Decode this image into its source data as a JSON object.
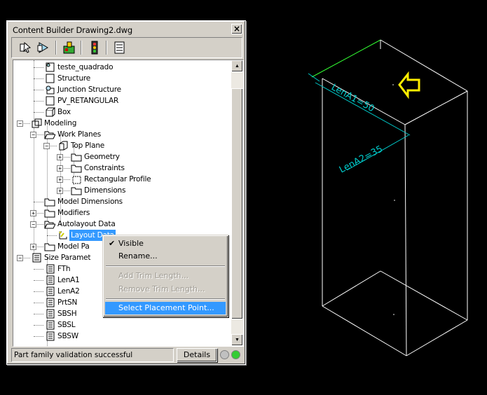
{
  "palette": {
    "title": "Content Builder Drawing2.dwg",
    "close_glyph": "×",
    "toolbar": [
      "model-icon",
      "browse-icon",
      "part-icon",
      "traffic-light-icon",
      "list-icon"
    ]
  },
  "tree": {
    "items": [
      {
        "label": "teste_quadrado",
        "icon": "part-doc-icon"
      },
      {
        "label": "Structure",
        "icon": "doc-icon"
      },
      {
        "label": "Junction Structure",
        "icon": "junction-icon"
      },
      {
        "label": "PV_RETANGULAR",
        "icon": "doc-icon"
      },
      {
        "label": "Box",
        "icon": "box-icon"
      },
      {
        "label": "Modeling",
        "icon": "modeling-icon",
        "expander": "−"
      },
      {
        "label": "Work Planes",
        "icon": "folder-open-icon",
        "expander": "−"
      },
      {
        "label": "Top Plane",
        "icon": "plane-icon",
        "expander": "−"
      },
      {
        "label": "Geometry",
        "icon": "folder-icon",
        "expander": "+"
      },
      {
        "label": "Constraints",
        "icon": "folder-icon",
        "expander": "+"
      },
      {
        "label": "Rectangular Profile",
        "icon": "profile-icon",
        "expander": "+"
      },
      {
        "label": "Dimensions",
        "icon": "folder-icon",
        "expander": "+"
      },
      {
        "label": "Model Dimensions",
        "icon": "folder-icon"
      },
      {
        "label": "Modifiers",
        "icon": "folder-icon",
        "expander": "+"
      },
      {
        "label": "Autolayout Data",
        "icon": "folder-open-icon",
        "expander": "−"
      },
      {
        "label": "Layout Data",
        "icon": "layout-data-icon",
        "selected": true
      },
      {
        "label": "Model Pa",
        "icon": "folder-icon",
        "expander": "+"
      },
      {
        "label": "Size Paramet",
        "icon": "size-params-icon",
        "expander": "−"
      },
      {
        "label": "FTh",
        "icon": "param-icon"
      },
      {
        "label": "LenA1",
        "icon": "param-icon"
      },
      {
        "label": "LenA2",
        "icon": "param-icon"
      },
      {
        "label": "PrtSN",
        "icon": "param-icon"
      },
      {
        "label": "SBSH",
        "icon": "param-icon"
      },
      {
        "label": "SBSL",
        "icon": "param-icon"
      },
      {
        "label": "SBSW",
        "icon": "param-icon"
      }
    ]
  },
  "scrollbar": {
    "up": "▲",
    "down": "▼"
  },
  "status": {
    "text": "Part family validation successful",
    "details_label": "Details",
    "lamp_colors": [
      "#c0c0c0",
      "#33cc33"
    ]
  },
  "context_menu": {
    "items": [
      {
        "label": "Visible",
        "checked": true,
        "check_glyph": "✔"
      },
      {
        "label": "Rename..."
      },
      {
        "label": "Add Trim Length...",
        "disabled": true
      },
      {
        "label": "Remove Trim Length...",
        "disabled": true
      },
      {
        "label": "Select Placement Point...",
        "highlighted": true
      }
    ]
  },
  "drawing": {
    "dim1": "LenA1=50",
    "dim2": "LenA2=35",
    "colors": {
      "edges": "#ffffff",
      "dimensions": "#00cccc",
      "top_edge": "#33ff33",
      "arrow": "#ffee00"
    }
  }
}
